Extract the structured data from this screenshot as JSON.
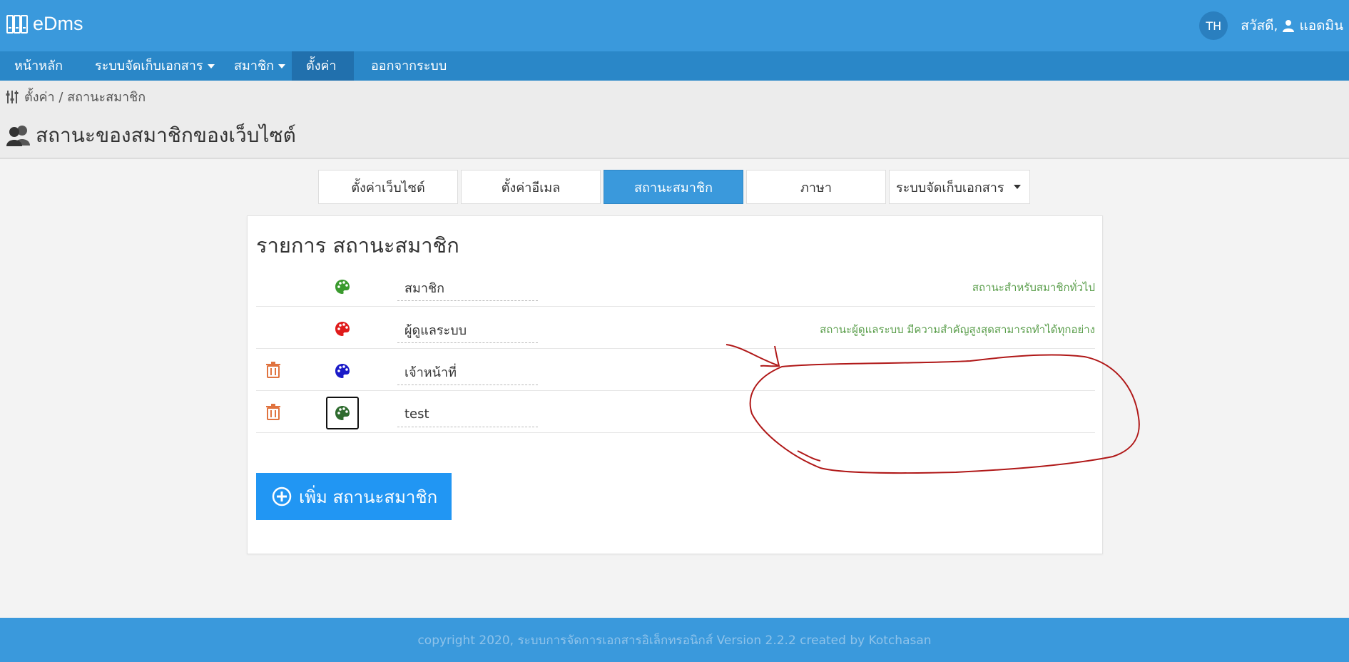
{
  "app": {
    "title": "eDms"
  },
  "user": {
    "lang": "TH",
    "greeting": "สวัสดี,",
    "name": "แอดมิน"
  },
  "nav": {
    "home": "หน้าหลัก",
    "docs": "ระบบจัดเก็บเอกสาร",
    "members": "สมาชิก",
    "settings": "ตั้งค่า",
    "logout": "ออกจากระบบ"
  },
  "breadcrumb": "ตั้งค่า / สถานะสมาชิก",
  "page_title": "สถานะของสมาชิกของเว็บไซต์",
  "tabs": {
    "site": "ตั้งค่าเว็บไซต์",
    "email": "ตั้งค่าอีเมล",
    "status": "สถานะสมาชิก",
    "language": "ภาษา",
    "docsys": "ระบบจัดเก็บเอกสาร"
  },
  "panel": {
    "title": "รายการ สถานะสมาชิก"
  },
  "rows": [
    {
      "name": "สมาชิก",
      "desc": "สถานะสำหรับสมาชิกทั่วไป",
      "color": "#3a9a2e",
      "deletable": false
    },
    {
      "name": "ผู้ดูแลระบบ",
      "desc": "สถานะผู้ดูแลระบบ มีความสำคัญสูงสุดสามารถทำได้ทุกอย่าง",
      "color": "#e01b1b",
      "deletable": false
    },
    {
      "name": "เจ้าหน้าที่",
      "desc": "",
      "color": "#1a1ac8",
      "deletable": true
    },
    {
      "name": "test",
      "desc": "",
      "color": "#2e6b2e",
      "deletable": true
    }
  ],
  "add_button": "เพิ่ม สถานะสมาชิก",
  "footer": "copyright 2020, ระบบการจัดการเอกสารอิเล็กทรอนิกส์ Version 2.2.2 created by Kotchasan",
  "icons": {
    "logo": "books-icon",
    "settings": "sliders-icon",
    "title": "users-icon",
    "row_color": "palette-icon",
    "delete": "trash-icon",
    "add": "plus-circle-icon",
    "user": "user-icon"
  },
  "colors": {
    "brand": "#3a99dc",
    "nav": "#2a87c8",
    "delete": "#e0733f",
    "desc": "#5a9e4b",
    "annotation": "#b01818"
  }
}
